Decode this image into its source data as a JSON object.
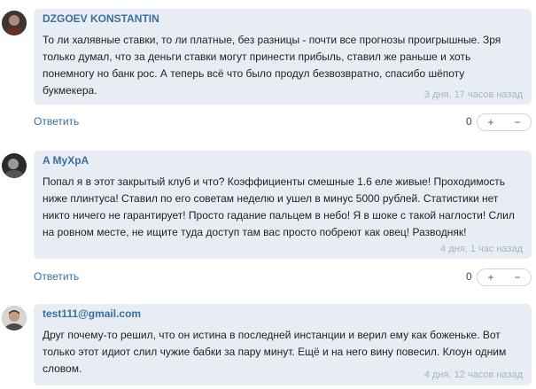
{
  "comments": [
    {
      "author": "DZGOEV KONSTANTIN",
      "text": "То ли халявные ставки, то ли платные, без разницы - почти все прогнозы проигрышные. Зря только думал, что за деньги ставки могут принести прибыль, ставил же раньше и хоть понемногу но банк рос. А теперь всё что было продул безвозвратно, спасибо шёпоту букмекера.",
      "time": "3 дня, 17 часов назад",
      "reply_label": "Ответить",
      "score": "0",
      "plus": "+",
      "minus": "−"
    },
    {
      "author": "A MyXpA",
      "text": "Попал я в этот закрытый клуб и что? Коэффициенты смешные 1.6 еле живые! Проходимость ниже плинтуса! Ставил по его советам неделю и ушел в минус 5000 рублей. Статистики нет никто ничего не гарантирует! Просто гадание пальцем в небо! Я в шоке с такой наглости! Слил на ровном месте, не ищите туда доступ там вас просто побреют как овец! Разводняк!",
      "time": "4 дня, 1 час назад",
      "reply_label": "Ответить",
      "score": "0",
      "plus": "+",
      "minus": "−"
    },
    {
      "author": "test111@gmail.com",
      "text": "Друг почему-то решил, что он истина в последней инстанции и верил ему как боженьке. Вот только этот идиот слил чужие бабки за пару минут. Ещё и на него вину повесил. Клоун одним словом.",
      "time": "4 дня, 12 часов назад"
    }
  ]
}
